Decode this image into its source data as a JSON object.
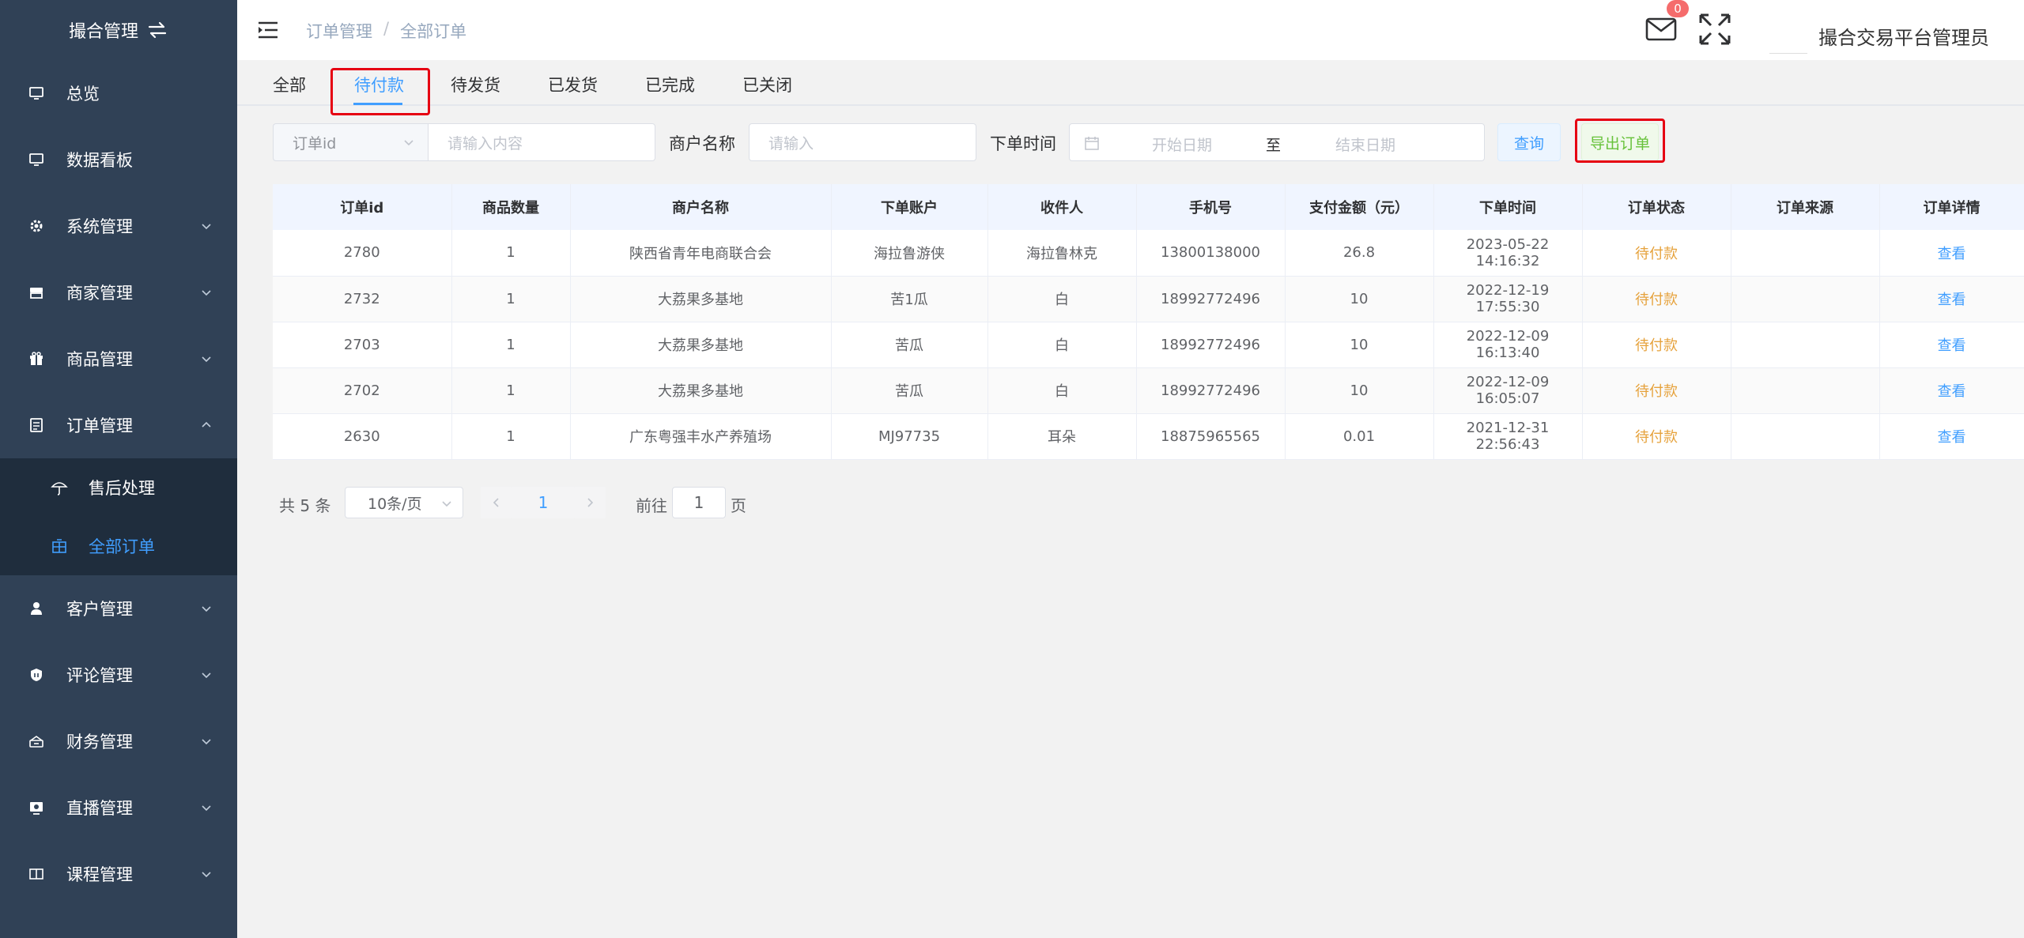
{
  "sidebar": {
    "logo_text": "撮合管理",
    "logo_icon": "swap-icon",
    "items": [
      {
        "label": "总览",
        "icon": "monitor-icon",
        "expandable": false
      },
      {
        "label": "数据看板",
        "icon": "monitor-icon",
        "expandable": false
      },
      {
        "label": "系统管理",
        "icon": "gear-icon",
        "expandable": true
      },
      {
        "label": "商家管理",
        "icon": "store-icon",
        "expandable": true
      },
      {
        "label": "商品管理",
        "icon": "gift-icon",
        "expandable": true
      },
      {
        "label": "订单管理",
        "icon": "document-icon",
        "expandable": true,
        "expanded": true
      }
    ],
    "sub_items": [
      {
        "label": "售后处理",
        "icon": "umbrella-icon",
        "active": false
      },
      {
        "label": "全部订单",
        "icon": "grid-icon",
        "active": true
      }
    ],
    "items_after": [
      {
        "label": "客户管理",
        "icon": "user-icon",
        "expandable": true
      },
      {
        "label": "评论管理",
        "icon": "shield-icon",
        "expandable": true
      },
      {
        "label": "财务管理",
        "icon": "wallet-icon",
        "expandable": true
      },
      {
        "label": "直播管理",
        "icon": "video-icon",
        "expandable": true
      },
      {
        "label": "课程管理",
        "icon": "book-icon",
        "expandable": true
      }
    ]
  },
  "header": {
    "breadcrumb": [
      "订单管理",
      "全部订单"
    ],
    "breadcrumb_sep": "/",
    "mail_badge": "0",
    "username": "撮合交易平台管理员"
  },
  "tabs": [
    {
      "label": "全部",
      "active": false
    },
    {
      "label": "待付款",
      "active": true
    },
    {
      "label": "待发货",
      "active": false
    },
    {
      "label": "已发货",
      "active": false
    },
    {
      "label": "已完成",
      "active": false
    },
    {
      "label": "已关闭",
      "active": false
    }
  ],
  "filter": {
    "field_select": "订单id",
    "content_placeholder": "请输入内容",
    "merchant_label": "商户名称",
    "merchant_placeholder": "请输入",
    "time_label": "下单时间",
    "start_placeholder": "开始日期",
    "range_sep": "至",
    "end_placeholder": "结束日期",
    "query_label": "查询",
    "export_label": "导出订单"
  },
  "table": {
    "columns": [
      "订单id",
      "商品数量",
      "商户名称",
      "下单账户",
      "收件人",
      "手机号",
      "支付金额（元）",
      "下单时间",
      "订单状态",
      "订单来源",
      "订单详情"
    ],
    "rows": [
      [
        "2780",
        "1",
        "陕西省青年电商联合会",
        "海拉鲁游侠",
        "海拉鲁林克",
        "13800138000",
        "26.8",
        "2023-05-22 14:16:32",
        "待付款",
        "",
        "查看"
      ],
      [
        "2732",
        "1",
        "大荔果多基地",
        "苦1瓜",
        "白",
        "18992772496",
        "10",
        "2022-12-19 17:55:30",
        "待付款",
        "",
        "查看"
      ],
      [
        "2703",
        "1",
        "大荔果多基地",
        "苦瓜",
        "白",
        "18992772496",
        "10",
        "2022-12-09 16:13:40",
        "待付款",
        "",
        "查看"
      ],
      [
        "2702",
        "1",
        "大荔果多基地",
        "苦瓜",
        "白",
        "18992772496",
        "10",
        "2022-12-09 16:05:07",
        "待付款",
        "",
        "查看"
      ],
      [
        "2630",
        "1",
        "广东粤强丰水产养殖场",
        "MJ97735",
        "耳朵",
        "18875965565",
        "0.01",
        "2021-12-31 22:56:43",
        "待付款",
        "",
        "查看"
      ]
    ]
  },
  "pagination": {
    "total": "共 5 条",
    "page_size": "10条/页",
    "current_page": "1",
    "goto_label": "前往",
    "goto_value": "1",
    "page_suffix": "页"
  },
  "colors": {
    "sidebar_bg": "#304156",
    "submenu_bg": "#1f2d3d",
    "accent": "#409eff",
    "warning": "#e6a23c",
    "success": "#67c23a",
    "highlight_box": "#e60012"
  }
}
